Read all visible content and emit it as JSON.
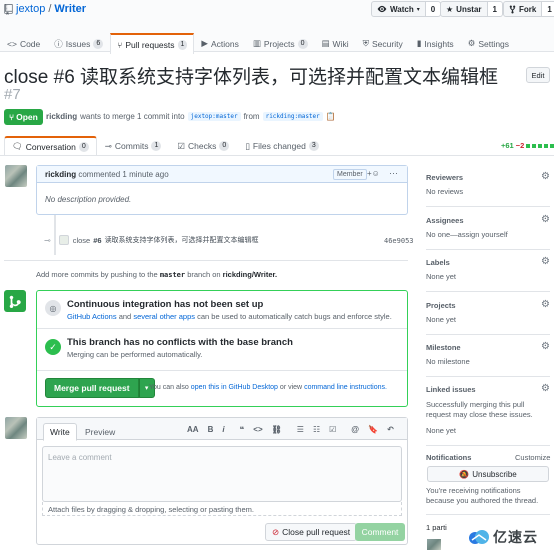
{
  "repo": {
    "owner": "jextop",
    "name": "Writer"
  },
  "repo_buttons": [
    {
      "label": "Watch",
      "count": "0"
    },
    {
      "label": "Unstar",
      "count": "1"
    },
    {
      "label": "Fork",
      "count": "1"
    }
  ],
  "repo_tabs": [
    {
      "label": "Code",
      "count": ""
    },
    {
      "label": "Issues",
      "count": "6"
    },
    {
      "label": "Pull requests",
      "count": "1"
    },
    {
      "label": "Actions",
      "count": ""
    },
    {
      "label": "Projects",
      "count": "0"
    },
    {
      "label": "Wiki",
      "count": ""
    },
    {
      "label": "Security",
      "count": ""
    },
    {
      "label": "Insights",
      "count": ""
    },
    {
      "label": "Settings",
      "count": ""
    }
  ],
  "pr": {
    "title": "close #6 读取系统支持字体列表，可选择并配置文本编辑框",
    "number": "#7",
    "edit_label": "Edit",
    "state": "Open",
    "author": "rickding",
    "meta_middle": "wants to merge 1 commit into",
    "base_branch": "jextop:master",
    "meta_from": "from",
    "head_branch": "rickding:master"
  },
  "pr_tabs": [
    {
      "label": "Conversation",
      "count": "0"
    },
    {
      "label": "Commits",
      "count": "1"
    },
    {
      "label": "Checks",
      "count": "0"
    },
    {
      "label": "Files changed",
      "count": "3"
    }
  ],
  "diffstat": {
    "add": "+61",
    "del": "−2"
  },
  "comment": {
    "author": "rickding",
    "action": "commented",
    "time": "1 minute ago",
    "badge": "Member",
    "body": "No description provided."
  },
  "commit": {
    "prefix": "close",
    "issue": "#6",
    "message": "读取系统支持字体列表，可选择并配置文本编辑框",
    "sha": "46e9053"
  },
  "add_more": {
    "pre": "Add more commits by pushing to the",
    "branch": "master",
    "mid": "branch on",
    "repo": "rickding/Writer."
  },
  "merge": {
    "ci_title": "Continuous integration has not been set up",
    "ci_link1": "GitHub Actions",
    "ci_and": "and",
    "ci_link2": "several other apps",
    "ci_rest": "can be used to automatically catch bugs and enforce style.",
    "ok_title": "This branch has no conflicts with the base branch",
    "ok_sub": "Merging can be performed automatically.",
    "button": "Merge pull request",
    "note_pre": "You can also",
    "note_link1": "open this in GitHub Desktop",
    "note_mid": "or view",
    "note_link2": "command line instructions."
  },
  "editor": {
    "tab_write": "Write",
    "tab_preview": "Preview",
    "tools": [
      "AA",
      "B",
      "i",
      "❝",
      "<>",
      "⛓",
      "☰",
      "☷",
      "☑",
      "@",
      "🔖",
      "↶"
    ],
    "placeholder": "Leave a comment",
    "attach": "Attach files by dragging & dropping, selecting or pasting them.",
    "close_button": "Close pull request",
    "comment_button": "Comment"
  },
  "sidebar": [
    {
      "title": "Reviewers",
      "value": "No reviews"
    },
    {
      "title": "Assignees",
      "value": "No one—assign yourself"
    },
    {
      "title": "Labels",
      "value": "None yet"
    },
    {
      "title": "Projects",
      "value": "None yet"
    },
    {
      "title": "Milestone",
      "value": "No milestone"
    },
    {
      "title": "Linked issues",
      "value": "Successfully merging this pull request may close these issues.",
      "value2": "None yet"
    }
  ],
  "notifications": {
    "title": "Notifications",
    "customize": "Customize",
    "button": "Unsubscribe",
    "note": "You're receiving notifications because you authored the thread."
  },
  "participants": {
    "label": "1 parti"
  },
  "watermark": {
    "text": "亿速云"
  },
  "colors": {
    "accent_orange": "#e36209",
    "green": "#28a745",
    "link": "#0366d6"
  }
}
